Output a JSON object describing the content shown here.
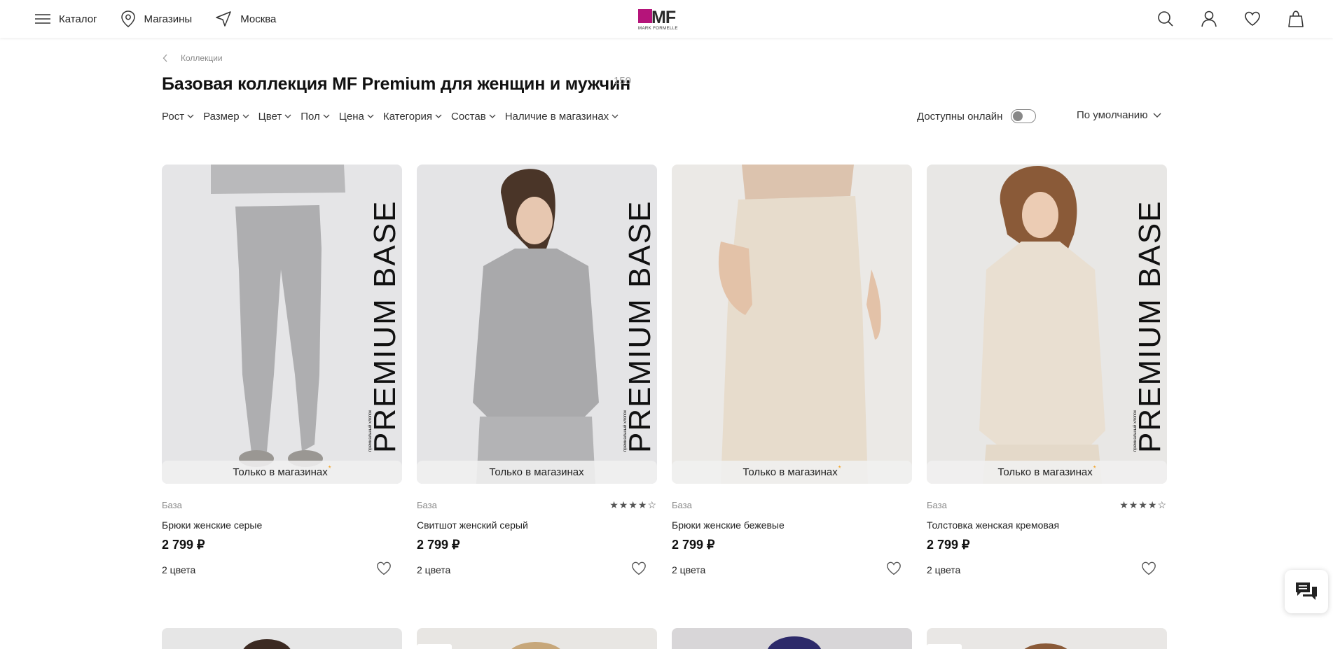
{
  "header": {
    "catalog_label": "Каталог",
    "stores_label": "Магазины",
    "city_label": "Москва",
    "logo_text": "MF",
    "logo_sub": "MARK FORMELLE",
    "brand_color": "#b5147a"
  },
  "breadcrumb": {
    "label": "Коллекции"
  },
  "page": {
    "title": "Базовая коллекция MF Premium для женщин и мужчин",
    "count": "150"
  },
  "filters": [
    {
      "label": "Рост"
    },
    {
      "label": "Размер"
    },
    {
      "label": "Цвет"
    },
    {
      "label": "Пол"
    },
    {
      "label": "Цена"
    },
    {
      "label": "Категория"
    },
    {
      "label": "Состав"
    },
    {
      "label": "Наличие в магазинах"
    }
  ],
  "online_toggle": {
    "label": "Доступны онлайн",
    "on": false
  },
  "sort": {
    "label": "По умолчанию"
  },
  "products": [
    {
      "banner": "PREMIUM BASE",
      "banner_small": "премиальный хлопок",
      "badge": "Только в магазинах",
      "badge_star": "*",
      "brand": "База",
      "name": "Брюки женские серые",
      "price": "2 799 ₽",
      "colors": "2 цвета",
      "rating": null,
      "tone": "gray"
    },
    {
      "banner": "PREMIUM BASE",
      "banner_small": "премиальный хлопок",
      "badge": "Только в магазинах",
      "badge_star": "",
      "brand": "База",
      "name": "Свитшот женский серый",
      "price": "2 799 ₽",
      "colors": "2 цвета",
      "rating": 4.5,
      "rating_text": "★★★★☆",
      "tone": "gray"
    },
    {
      "banner": "",
      "banner_small": "",
      "badge": "Только в магазинах",
      "badge_star": "*",
      "brand": "База",
      "name": "Брюки женские бежевые",
      "price": "2 799 ₽",
      "colors": "2 цвета",
      "rating": null,
      "tone": "beige"
    },
    {
      "banner": "PREMIUM BASE",
      "banner_small": "премиальный хлопок",
      "badge": "Только в магазинах",
      "badge_star": "*",
      "brand": "База",
      "name": "Толстовка женская кремовая",
      "price": "2 799 ₽",
      "colors": "2 цвета",
      "rating": 4.5,
      "rating_text": "★★★★☆",
      "tone": "beige"
    }
  ],
  "colors": {
    "gray_bg": "#e4e4e6",
    "beige_bg": "#ebe8e4",
    "accent_star": "#f39c12"
  }
}
